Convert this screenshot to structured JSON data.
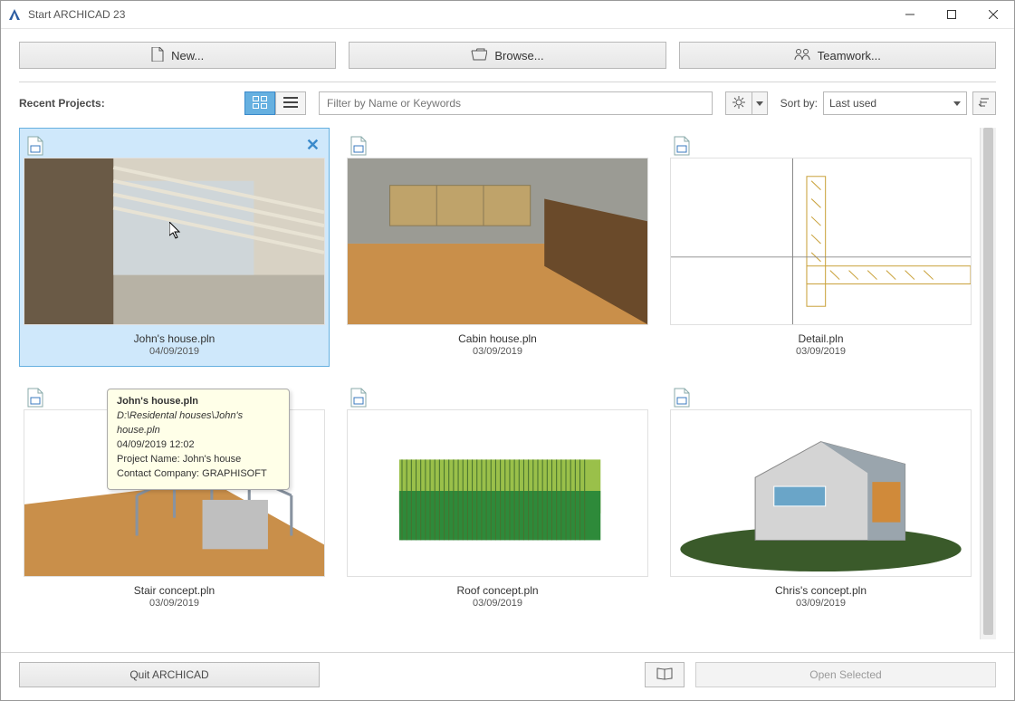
{
  "window": {
    "title": "Start ARCHICAD 23"
  },
  "top_buttons": {
    "new": "New...",
    "browse": "Browse...",
    "teamwork": "Teamwork..."
  },
  "toolbar": {
    "recent_label": "Recent Projects:",
    "filter_placeholder": "Filter by Name or Keywords",
    "sort_label": "Sort by:",
    "sort_value": "Last used"
  },
  "projects": [
    {
      "name": "John's house.pln",
      "date": "04/09/2019",
      "selected": true
    },
    {
      "name": "Cabin house.pln",
      "date": "03/09/2019",
      "selected": false
    },
    {
      "name": "Detail.pln",
      "date": "03/09/2019",
      "selected": false
    },
    {
      "name": "Stair concept.pln",
      "date": "03/09/2019",
      "selected": false
    },
    {
      "name": "Roof concept.pln",
      "date": "03/09/2019",
      "selected": false
    },
    {
      "name": "Chris's concept.pln",
      "date": "03/09/2019",
      "selected": false
    }
  ],
  "tooltip": {
    "title": "John's house.pln",
    "path": "D:\\Residental houses\\John's house.pln",
    "datetime": "04/09/2019 12:02",
    "project_name": "Project Name: John's house",
    "company": "Contact Company: GRAPHISOFT"
  },
  "bottom": {
    "quit": "Quit ARCHICAD",
    "open": "Open Selected"
  }
}
